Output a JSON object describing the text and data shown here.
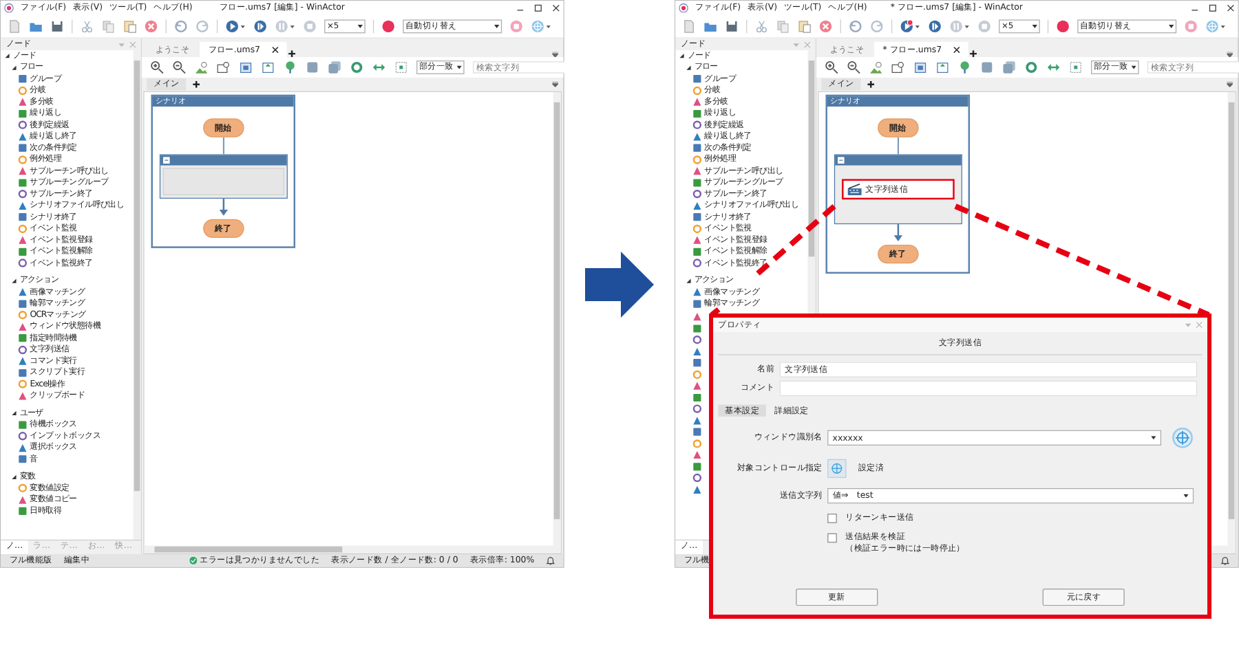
{
  "windows": [
    {
      "title": "フロー.ums7 [編集] - WinActor",
      "menu": [
        "ファイル(F)",
        "表示(V)",
        "ツール(T)",
        "ヘルプ(H)"
      ],
      "toolbar": {
        "speed": "×5",
        "record_mode": "自動切り替え",
        "play_alert": false
      },
      "node_panel": {
        "title": "ノード",
        "partly_covered": false,
        "tree": [
          {
            "label": "ノード",
            "expanded": true,
            "children": [
              {
                "label": "フロー",
                "expanded": true,
                "children": [
                  {
                    "label": "グループ"
                  },
                  {
                    "label": "分岐"
                  },
                  {
                    "label": "多分岐"
                  },
                  {
                    "label": "繰り返し"
                  },
                  {
                    "label": "後判定繰返"
                  },
                  {
                    "label": "繰り返し終了"
                  },
                  {
                    "label": "次の条件判定"
                  },
                  {
                    "label": "例外処理"
                  },
                  {
                    "label": "サブルーチン呼び出し"
                  },
                  {
                    "label": "サブルーチングループ"
                  },
                  {
                    "label": "サブルーチン終了"
                  },
                  {
                    "label": "シナリオファイル呼び出し"
                  },
                  {
                    "label": "シナリオ終了"
                  },
                  {
                    "label": "イベント監視"
                  },
                  {
                    "label": "イベント監視登録"
                  },
                  {
                    "label": "イベント監視解除"
                  },
                  {
                    "label": "イベント監視終了"
                  }
                ]
              },
              {
                "label": "アクション",
                "expanded": true,
                "children": [
                  {
                    "label": "画像マッチング"
                  },
                  {
                    "label": "輪郭マッチング"
                  },
                  {
                    "label": "OCRマッチング"
                  },
                  {
                    "label": "ウィンドウ状態待機"
                  },
                  {
                    "label": "指定時間待機"
                  },
                  {
                    "label": "文字列送信"
                  },
                  {
                    "label": "コマンド実行"
                  },
                  {
                    "label": "スクリプト実行"
                  },
                  {
                    "label": "Excel操作"
                  },
                  {
                    "label": "クリップボード"
                  }
                ]
              },
              {
                "label": "ユーザ",
                "expanded": true,
                "children": [
                  {
                    "label": "待機ボックス"
                  },
                  {
                    "label": "インプットボックス"
                  },
                  {
                    "label": "選択ボックス"
                  },
                  {
                    "label": "音"
                  }
                ]
              },
              {
                "label": "変数",
                "expanded": true,
                "children": [
                  {
                    "label": "変数値設定"
                  },
                  {
                    "label": "変数値コピー"
                  },
                  {
                    "label": "日時取得"
                  }
                ]
              }
            ]
          }
        ],
        "bottom_tabs": [
          {
            "label": "ノ…",
            "selected": true
          },
          {
            "label": "ラ…",
            "selected": false
          },
          {
            "label": "テ…",
            "selected": false
          },
          {
            "label": "お…",
            "selected": false
          },
          {
            "label": "快…",
            "selected": false
          }
        ]
      },
      "doc_tabs": [
        {
          "label": "ようこそ",
          "selected": false
        },
        {
          "label": "フロー.ums7",
          "selected": true
        }
      ],
      "search": {
        "mode": "部分一致",
        "placeholder": "検索文字列"
      },
      "sheet_tabs": [
        {
          "label": "メイン",
          "selected": true
        }
      ],
      "scenario": {
        "title": "シナリオ",
        "start": "開始",
        "end": "終了"
      },
      "status_bar": {
        "mode": "フル機能版",
        "state": "編集中",
        "message": "エラーは見つかりませんでした",
        "counts": "表示ノード数 / 全ノード数: 0 / 0",
        "zoom": "表示倍率: 100%"
      }
    },
    {
      "title": "* フロー.ums7 [編集] - WinActor",
      "menu": [
        "ファイル(F)",
        "表示(V)",
        "ツール(T)",
        "ヘルプ(H)"
      ],
      "toolbar": {
        "speed": "×5",
        "record_mode": "自動切り替え",
        "play_alert": true
      },
      "node_panel": {
        "title": "ノード",
        "partly_covered": true,
        "tree": [
          {
            "label": "ノード",
            "expanded": true,
            "children": [
              {
                "label": "フロー",
                "expanded": true,
                "children": [
                  {
                    "label": "グループ"
                  },
                  {
                    "label": "分岐"
                  },
                  {
                    "label": "多分岐"
                  },
                  {
                    "label": "繰り返し"
                  },
                  {
                    "label": "後判定繰返"
                  },
                  {
                    "label": "繰り返し終了"
                  },
                  {
                    "label": "次の条件判定"
                  },
                  {
                    "label": "例外処理"
                  },
                  {
                    "label": "サブルーチン呼び出し"
                  },
                  {
                    "label": "サブルーチングループ"
                  },
                  {
                    "label": "サブルーチン終了"
                  },
                  {
                    "label": "シナリオファイル呼び出し"
                  },
                  {
                    "label": "シナリオ終了"
                  },
                  {
                    "label": "イベント監視"
                  },
                  {
                    "label": "イベント監視登録"
                  },
                  {
                    "label": "イベント監視解除"
                  },
                  {
                    "label": "イベント監視終了"
                  }
                ]
              },
              {
                "label": "アクション",
                "expanded": true,
                "children": [
                  {
                    "label": "画像マッチング"
                  },
                  {
                    "label": "輪郭マッチング"
                  }
                ]
              }
            ]
          }
        ],
        "bottom_tabs": [
          {
            "label": "ノ…",
            "selected": true
          }
        ]
      },
      "doc_tabs": [
        {
          "label": "ようこそ",
          "selected": false
        },
        {
          "label": "* フロー.ums7",
          "selected": true
        }
      ],
      "search": {
        "mode": "部分一致",
        "placeholder": "検索文字列"
      },
      "sheet_tabs": [
        {
          "label": "メイン",
          "selected": true
        }
      ],
      "scenario": {
        "title": "シナリオ",
        "start": "開始",
        "end": "終了",
        "nodes": [
          {
            "label": "文字列送信",
            "highlighted": true
          }
        ]
      },
      "status_bar": {
        "mode": "フル機"
      }
    }
  ],
  "properties": {
    "title": "プロパティ",
    "heading": "文字列送信",
    "name_label": "名前",
    "name_value": "文字列送信",
    "comment_label": "コメント",
    "tabs": [
      {
        "label": "基本設定",
        "selected": true
      },
      {
        "label": "詳細設定",
        "selected": false
      }
    ],
    "window_label": "ウィンドウ識別名",
    "window_value": "xxxxxx",
    "control_label": "対象コントロール指定",
    "control_status": "設定済",
    "send_label": "送信文字列",
    "send_type": "値⇒",
    "send_value": "test",
    "options": [
      {
        "lines": [
          "リターンキー送信"
        ],
        "checked": false
      },
      {
        "lines": [
          "送信結果を検証",
          "（検証エラー時には一時停止）"
        ],
        "checked": false
      }
    ],
    "buttons": [
      "更新",
      "元に戻す"
    ]
  }
}
